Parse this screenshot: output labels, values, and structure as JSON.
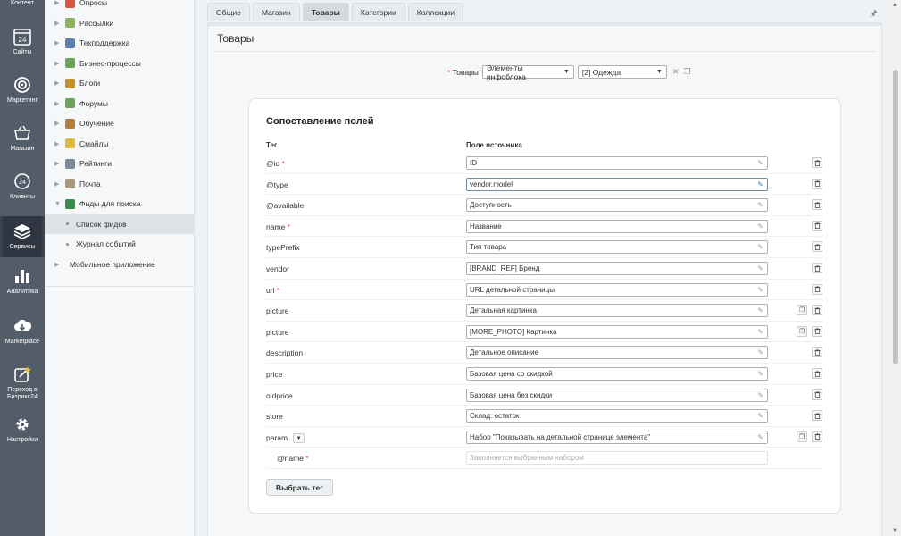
{
  "left_menu": [
    {
      "label": "Контент",
      "icon": "content-icon"
    },
    {
      "label": "Сайты",
      "icon": "calendar-24-icon"
    },
    {
      "label": "Маркетинг",
      "icon": "target-icon"
    },
    {
      "label": "Магазин",
      "icon": "basket-icon"
    },
    {
      "label": "Клиенты",
      "icon": "clients-24-icon"
    },
    {
      "label": "Сервисы",
      "icon": "layers-icon",
      "active": true
    },
    {
      "label": "Аналитика",
      "icon": "bar-chart-icon"
    },
    {
      "label": "Marketplace",
      "icon": "cloud-download-icon"
    },
    {
      "label": "Переход в Битрикс24",
      "icon": "transition-icon"
    },
    {
      "label": "Настройки",
      "icon": "gear-icon"
    }
  ],
  "sub_menu": [
    {
      "label": "Опросы",
      "icon_color": "#d8563f"
    },
    {
      "label": "Рассылки",
      "icon_color": "#8bb45b"
    },
    {
      "label": "Техподдержка",
      "icon_color": "#5a7fb0"
    },
    {
      "label": "Бизнес-процессы",
      "icon_color": "#6aa35a"
    },
    {
      "label": "Блоги",
      "icon_color": "#c4922a"
    },
    {
      "label": "Форумы",
      "icon_color": "#6aa35a"
    },
    {
      "label": "Обучение",
      "icon_color": "#b47d3c"
    },
    {
      "label": "Смайлы",
      "icon_color": "#e0b93a"
    },
    {
      "label": "Рейтинги",
      "icon_color": "#7a8a9a"
    },
    {
      "label": "Почта",
      "icon_color": "#a89a7a"
    },
    {
      "label": "Фиды для поиска",
      "icon_color": "#3a8a4a",
      "expanded": true
    },
    {
      "label": "Список фидов",
      "sub": true,
      "selected": true
    },
    {
      "label": "Журнал событий",
      "sub": true
    },
    {
      "label": "Мобильное приложение",
      "icon_color": null
    }
  ],
  "tabs": [
    "Общие",
    "Магазин",
    "Товары",
    "Категории",
    "Коллекции"
  ],
  "panel": {
    "title": "Товары",
    "source_label": "Товары",
    "source_type": "Элементы инфоблока",
    "source_iblock": "[2] Одежда"
  },
  "card": {
    "title": "Сопоставление полей",
    "col_tag": "Тег",
    "col_source": "Поле источника",
    "choose_tag": "Выбрать тег"
  },
  "rows": [
    {
      "tag": "@id",
      "required": true,
      "value": "ID",
      "copy": false
    },
    {
      "tag": "@type",
      "required": false,
      "value": "vendor.model",
      "copy": false,
      "focused": true
    },
    {
      "tag": "@available",
      "required": false,
      "value": "Доступность",
      "copy": false
    },
    {
      "tag": "name",
      "required": true,
      "value": "Название",
      "copy": false
    },
    {
      "tag": "typePrefix",
      "required": false,
      "value": "Тип товара",
      "copy": false
    },
    {
      "tag": "vendor",
      "required": false,
      "value": "[BRAND_REF] Бренд",
      "copy": false
    },
    {
      "tag": "url",
      "required": true,
      "value": "URL детальной страницы",
      "copy": false
    },
    {
      "tag": "picture",
      "required": false,
      "value": "Детальная картинка",
      "copy": true
    },
    {
      "tag": "picture",
      "required": false,
      "value": "[MORE_PHOTO] Картинка",
      "copy": true
    },
    {
      "tag": "description",
      "required": false,
      "value": "Детальное описание",
      "copy": false
    },
    {
      "tag": "price",
      "required": false,
      "value": "Базовая цена со скидкой",
      "copy": false
    },
    {
      "tag": "oldprice",
      "required": false,
      "value": "Базовая цена без скидки",
      "copy": false
    },
    {
      "tag": "store",
      "required": false,
      "value": "Склад: остаток",
      "copy": false
    },
    {
      "tag": "param",
      "required": false,
      "value": "Набор \"Показывать на детальной странице элемента\"",
      "copy": true,
      "dropdown": true
    },
    {
      "tag": "@name",
      "required": true,
      "placeholder": "Заполняется выбранным набором",
      "indent": true
    }
  ]
}
